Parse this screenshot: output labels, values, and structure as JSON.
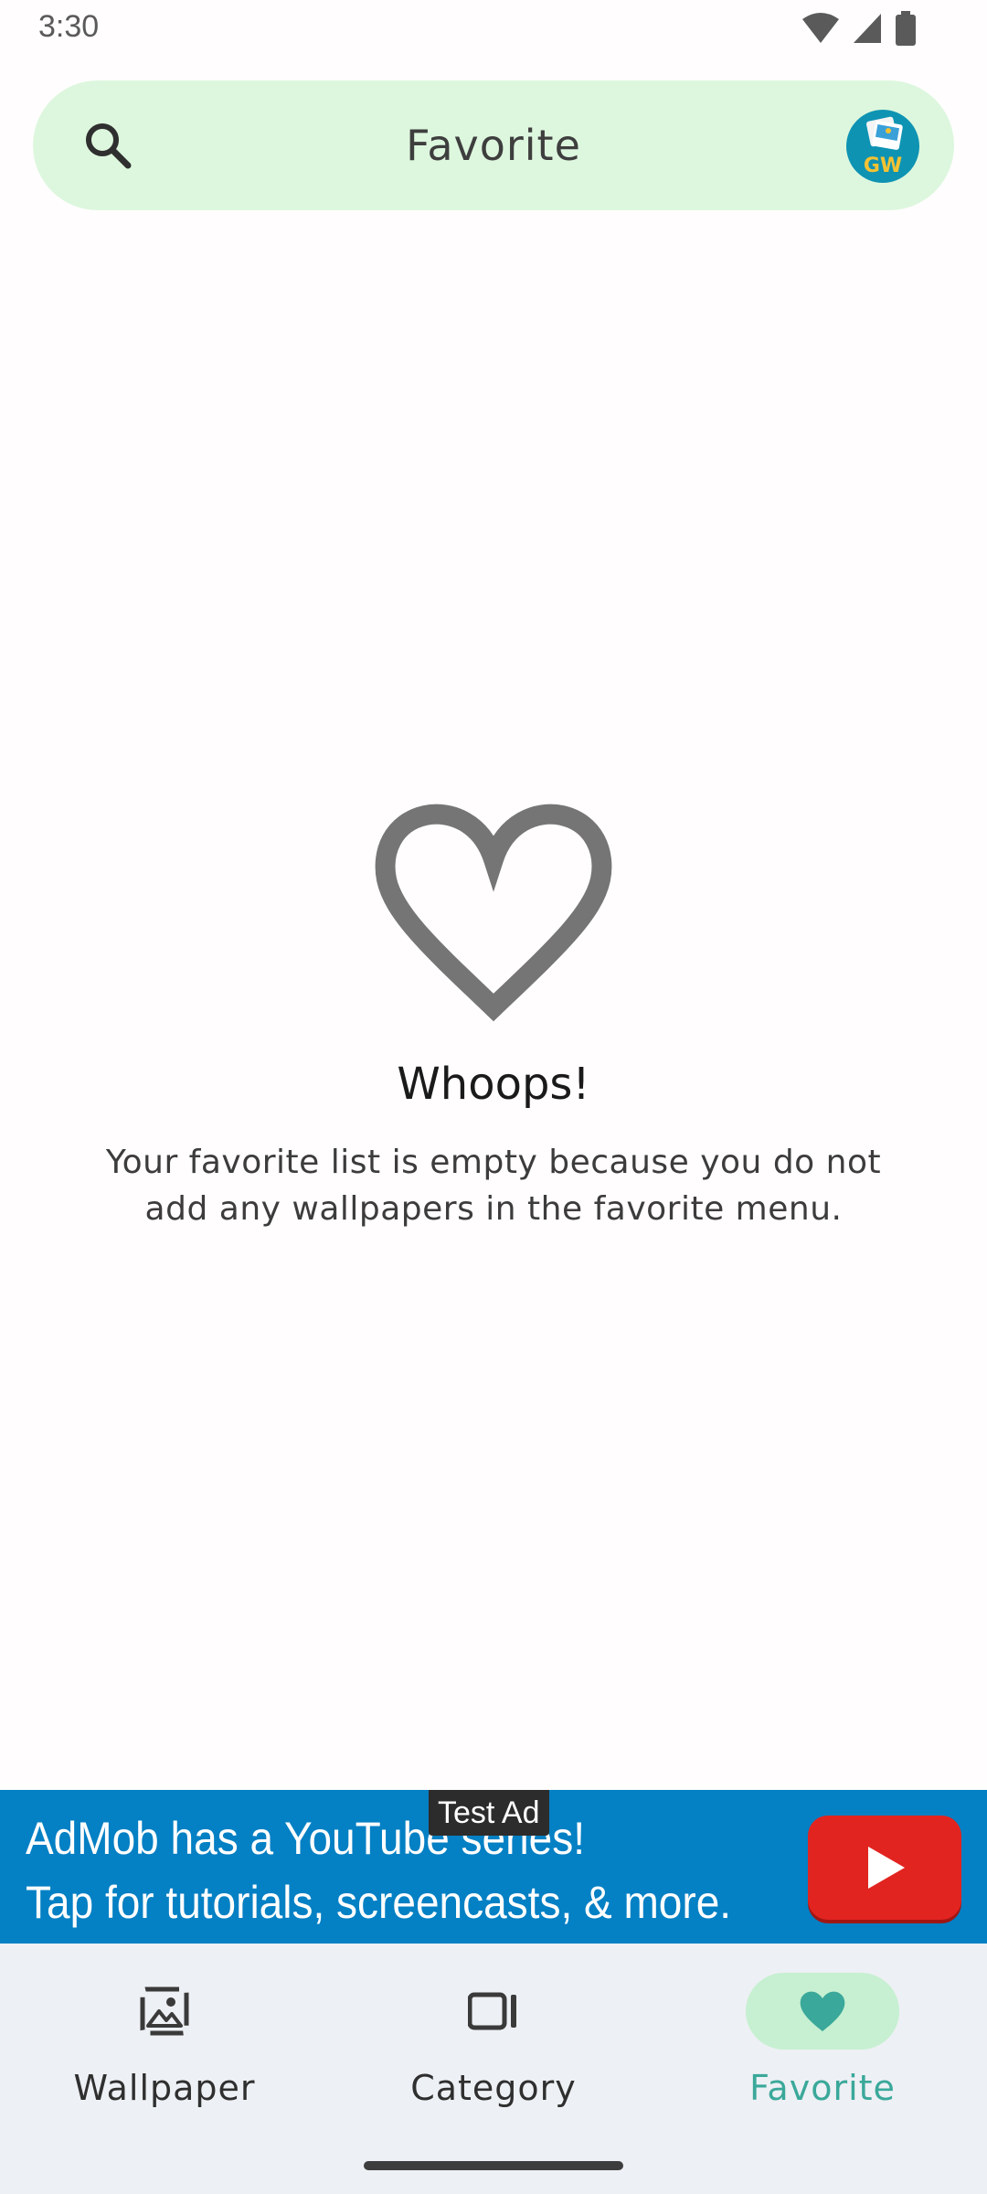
{
  "status_bar": {
    "time": "3:30",
    "icons": [
      "wifi-icon",
      "signal-icon",
      "battery-icon"
    ]
  },
  "top_bar": {
    "title": "Favorite",
    "search_icon": "search-icon",
    "avatar_text": "GW"
  },
  "empty_state": {
    "icon": "heart-outline-icon",
    "title": "Whoops!",
    "message": "Your favorite list is empty because you do not add any wallpapers in the favorite menu."
  },
  "ad": {
    "badge": "Test Ad",
    "line1": "AdMob has a YouTube series!",
    "line2": "Tap for tutorials, screencasts, & more.",
    "icon": "youtube-play-icon"
  },
  "bottom_nav": {
    "items": [
      {
        "label": "Wallpaper",
        "icon": "wallpaper-icon",
        "active": false
      },
      {
        "label": "Category",
        "icon": "category-icon",
        "active": false
      },
      {
        "label": "Favorite",
        "icon": "heart-icon",
        "active": true
      }
    ]
  },
  "colors": {
    "top_bar_bg": "#ddf7de",
    "accent": "#3aa89a",
    "active_pill": "#c6f0d1",
    "ad_bg": "#0480c4",
    "nav_bg": "#edf0f4"
  }
}
